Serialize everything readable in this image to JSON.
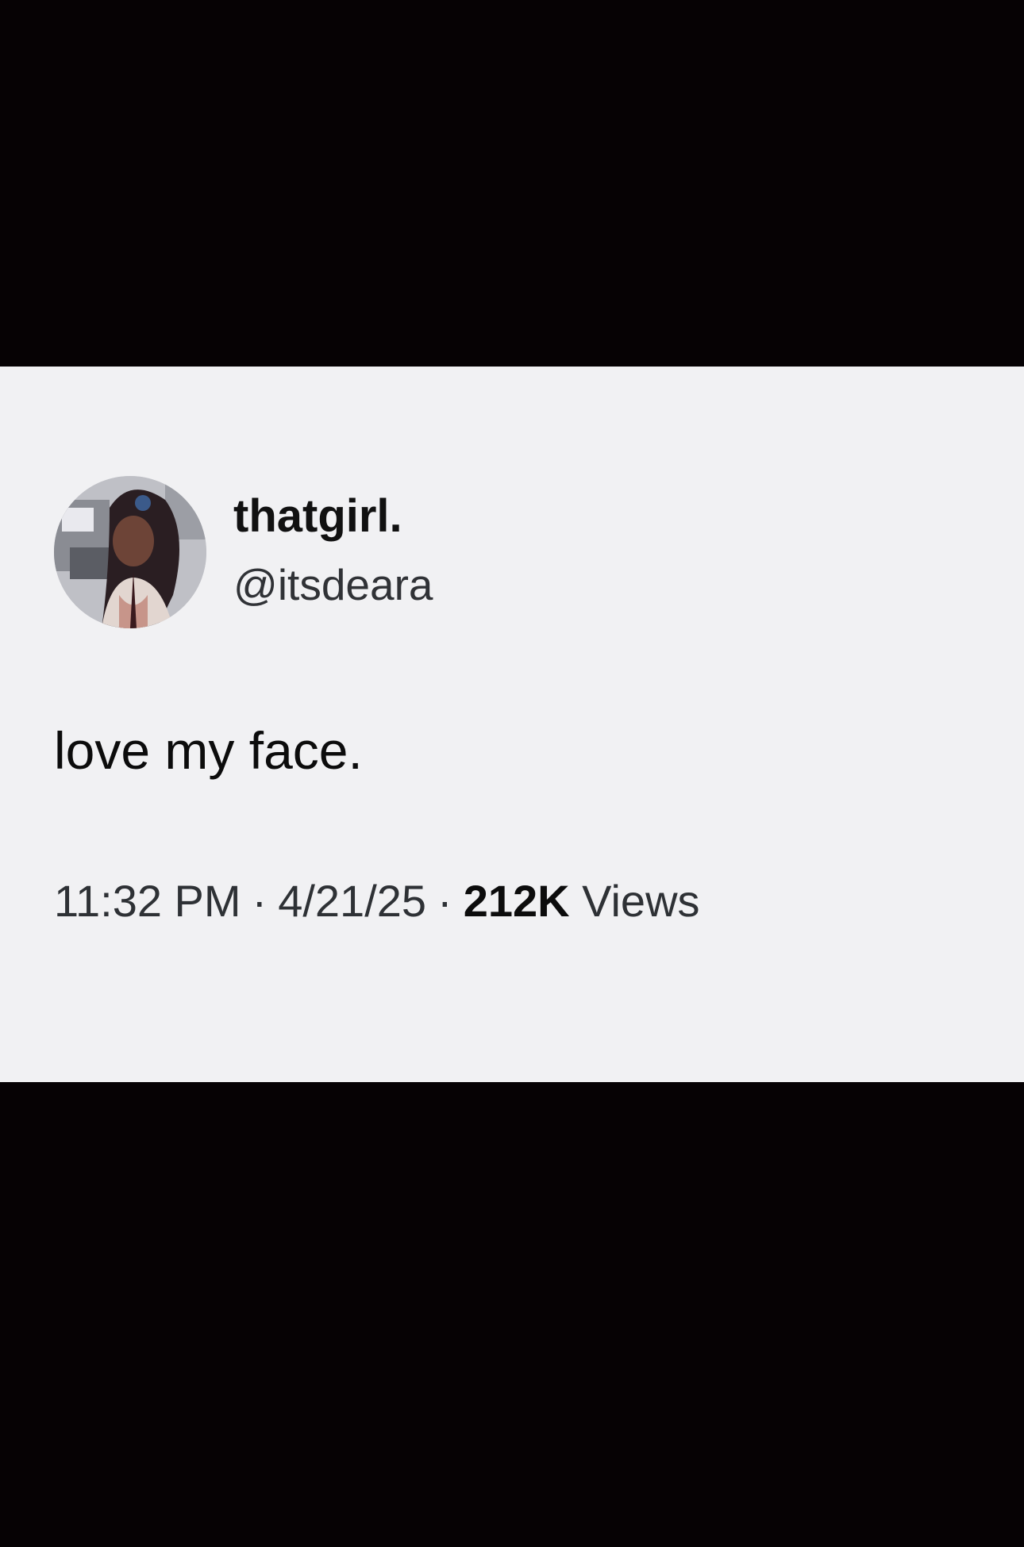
{
  "tweet": {
    "display_name": "thatgirl.",
    "handle": "@itsdeara",
    "text": "love my face.",
    "time": "11:32 PM",
    "separator": "·",
    "date": "4/21/25",
    "views_count": "212K",
    "views_label": "Views"
  },
  "colors": {
    "letterbox": "#060204",
    "card_background": "#f1f1f3",
    "text_primary": "#0c0c0c",
    "text_secondary": "#2e3135"
  }
}
